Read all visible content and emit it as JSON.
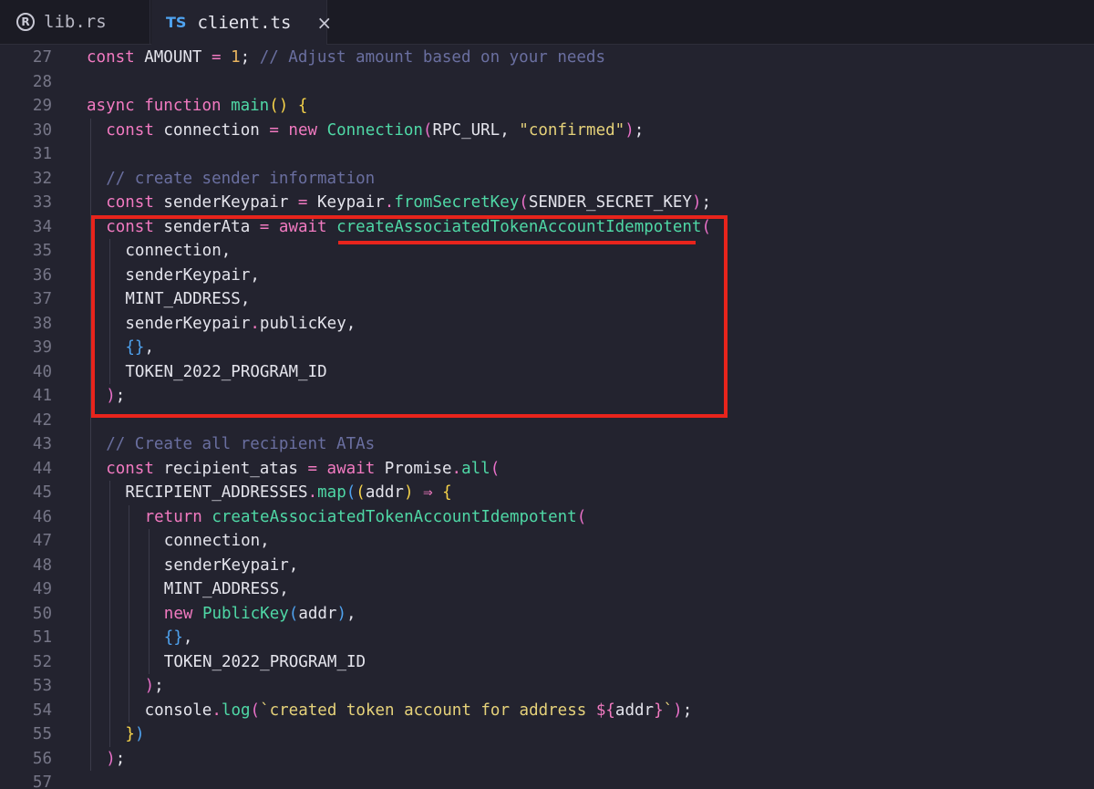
{
  "tabs": [
    {
      "label": "lib.rs",
      "icon": "rust-icon",
      "active": false
    },
    {
      "label": "client.ts",
      "icon_text": "TS",
      "active": true,
      "close": "×"
    }
  ],
  "lines": [
    {
      "n": "27",
      "indent": 0,
      "tokens": [
        [
          "kw",
          "const"
        ],
        [
          "t",
          " AMOUNT "
        ],
        [
          "op",
          "="
        ],
        [
          "t",
          " "
        ],
        [
          "num",
          "1"
        ],
        [
          "t",
          "; "
        ],
        [
          "cm",
          "// Adjust amount based on your needs"
        ]
      ]
    },
    {
      "n": "28",
      "indent": 0,
      "tokens": []
    },
    {
      "n": "29",
      "indent": 0,
      "tokens": [
        [
          "kw",
          "async"
        ],
        [
          "t",
          " "
        ],
        [
          "kw",
          "function"
        ],
        [
          "t",
          " "
        ],
        [
          "fn",
          "main"
        ],
        [
          "b1",
          "()"
        ],
        [
          "t",
          " "
        ],
        [
          "b1",
          "{"
        ]
      ]
    },
    {
      "n": "30",
      "indent": 1,
      "tokens": [
        [
          "kw",
          "const"
        ],
        [
          "t",
          " connection "
        ],
        [
          "op",
          "="
        ],
        [
          "t",
          " "
        ],
        [
          "kw",
          "new"
        ],
        [
          "t",
          " "
        ],
        [
          "fn",
          "Connection"
        ],
        [
          "b2",
          "("
        ],
        [
          "t",
          "RPC_URL, "
        ],
        [
          "str",
          "\"confirmed\""
        ],
        [
          "b2",
          ")"
        ],
        [
          "t",
          ";"
        ]
      ]
    },
    {
      "n": "31",
      "indent": 1,
      "tokens": []
    },
    {
      "n": "32",
      "indent": 1,
      "tokens": [
        [
          "cm",
          "// create sender information"
        ]
      ]
    },
    {
      "n": "33",
      "indent": 1,
      "tokens": [
        [
          "kw",
          "const"
        ],
        [
          "t",
          " senderKeypair "
        ],
        [
          "op",
          "="
        ],
        [
          "t",
          " Keypair"
        ],
        [
          "op",
          "."
        ],
        [
          "fn",
          "fromSecretKey"
        ],
        [
          "b2",
          "("
        ],
        [
          "t",
          "SENDER_SECRET_KEY"
        ],
        [
          "b2",
          ")"
        ],
        [
          "t",
          ";"
        ]
      ]
    },
    {
      "n": "34",
      "indent": 1,
      "tokens": [
        [
          "kw",
          "const"
        ],
        [
          "t",
          " senderAta "
        ],
        [
          "op",
          "="
        ],
        [
          "t",
          " "
        ],
        [
          "kw",
          "await"
        ],
        [
          "t",
          " "
        ],
        [
          "fn",
          "createAssociatedTokenAccountIdempotent"
        ],
        [
          "b2",
          "("
        ]
      ]
    },
    {
      "n": "35",
      "indent": 2,
      "tokens": [
        [
          "t",
          "connection,"
        ]
      ]
    },
    {
      "n": "36",
      "indent": 2,
      "tokens": [
        [
          "t",
          "senderKeypair,"
        ]
      ]
    },
    {
      "n": "37",
      "indent": 2,
      "tokens": [
        [
          "t",
          "MINT_ADDRESS,"
        ]
      ]
    },
    {
      "n": "38",
      "indent": 2,
      "tokens": [
        [
          "t",
          "senderKeypair"
        ],
        [
          "op",
          "."
        ],
        [
          "t",
          "publicKey,"
        ]
      ]
    },
    {
      "n": "39",
      "indent": 2,
      "tokens": [
        [
          "b3",
          "{}"
        ],
        [
          "t",
          ","
        ]
      ]
    },
    {
      "n": "40",
      "indent": 2,
      "tokens": [
        [
          "t",
          "TOKEN_2022_PROGRAM_ID"
        ]
      ]
    },
    {
      "n": "41",
      "indent": 1,
      "tokens": [
        [
          "b2",
          ")"
        ],
        [
          "t",
          ";"
        ]
      ]
    },
    {
      "n": "42",
      "indent": 1,
      "tokens": []
    },
    {
      "n": "43",
      "indent": 1,
      "tokens": [
        [
          "cm",
          "// Create all recipient ATAs"
        ]
      ]
    },
    {
      "n": "44",
      "indent": 1,
      "tokens": [
        [
          "kw",
          "const"
        ],
        [
          "t",
          " recipient_atas "
        ],
        [
          "op",
          "="
        ],
        [
          "t",
          " "
        ],
        [
          "kw",
          "await"
        ],
        [
          "t",
          " Promise"
        ],
        [
          "op",
          "."
        ],
        [
          "fn",
          "all"
        ],
        [
          "b2",
          "("
        ]
      ]
    },
    {
      "n": "45",
      "indent": 2,
      "tokens": [
        [
          "t",
          "RECIPIENT_ADDRESSES"
        ],
        [
          "op",
          "."
        ],
        [
          "fn",
          "map"
        ],
        [
          "b3",
          "("
        ],
        [
          "b1",
          "("
        ],
        [
          "t",
          "addr"
        ],
        [
          "b1",
          ")"
        ],
        [
          "t",
          " "
        ],
        [
          "op",
          "⇒"
        ],
        [
          "t",
          " "
        ],
        [
          "b1",
          "{"
        ]
      ]
    },
    {
      "n": "46",
      "indent": 3,
      "tokens": [
        [
          "kw",
          "return"
        ],
        [
          "t",
          " "
        ],
        [
          "fn",
          "createAssociatedTokenAccountIdempotent"
        ],
        [
          "b2",
          "("
        ]
      ]
    },
    {
      "n": "47",
      "indent": 4,
      "tokens": [
        [
          "t",
          "connection,"
        ]
      ]
    },
    {
      "n": "48",
      "indent": 4,
      "tokens": [
        [
          "t",
          "senderKeypair,"
        ]
      ]
    },
    {
      "n": "49",
      "indent": 4,
      "tokens": [
        [
          "t",
          "MINT_ADDRESS,"
        ]
      ]
    },
    {
      "n": "50",
      "indent": 4,
      "tokens": [
        [
          "kw",
          "new"
        ],
        [
          "t",
          " "
        ],
        [
          "fn",
          "PublicKey"
        ],
        [
          "b3",
          "("
        ],
        [
          "t",
          "addr"
        ],
        [
          "b3",
          ")"
        ],
        [
          "t",
          ","
        ]
      ]
    },
    {
      "n": "51",
      "indent": 4,
      "tokens": [
        [
          "b3",
          "{}"
        ],
        [
          "t",
          ","
        ]
      ]
    },
    {
      "n": "52",
      "indent": 4,
      "tokens": [
        [
          "t",
          "TOKEN_2022_PROGRAM_ID"
        ]
      ]
    },
    {
      "n": "53",
      "indent": 3,
      "tokens": [
        [
          "b2",
          ")"
        ],
        [
          "t",
          ";"
        ]
      ]
    },
    {
      "n": "54",
      "indent": 3,
      "tokens": [
        [
          "t",
          "console"
        ],
        [
          "op",
          "."
        ],
        [
          "fn",
          "log"
        ],
        [
          "b2",
          "("
        ],
        [
          "str",
          "`created token account for address "
        ],
        [
          "kw",
          "${"
        ],
        [
          "t",
          "addr"
        ],
        [
          "kw",
          "}"
        ],
        [
          "str",
          "`"
        ],
        [
          "b2",
          ")"
        ],
        [
          "t",
          ";"
        ]
      ]
    },
    {
      "n": "55",
      "indent": 2,
      "tokens": [
        [
          "b1",
          "}"
        ],
        [
          "b3",
          ")"
        ]
      ]
    },
    {
      "n": "56",
      "indent": 1,
      "tokens": [
        [
          "b2",
          ")"
        ],
        [
          "t",
          ";"
        ]
      ]
    },
    {
      "n": "57",
      "indent": 0,
      "tokens": []
    }
  ],
  "highlight": {
    "color": "#e8241c",
    "target": "createAssociatedTokenAccountIdempotent"
  }
}
